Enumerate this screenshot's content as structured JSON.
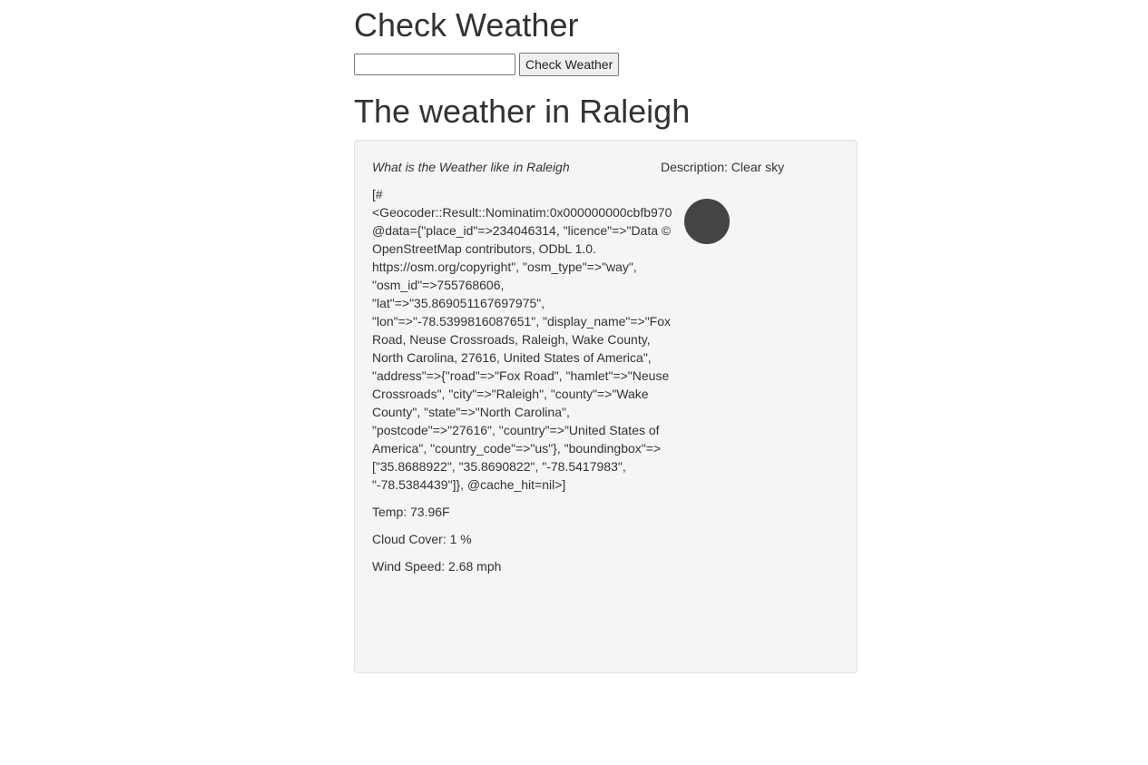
{
  "header": {
    "title": "Check Weather"
  },
  "search": {
    "input_value": "",
    "button_label": "Check Weather"
  },
  "result": {
    "heading": "The weather in Raleigh",
    "question": "What is the Weather like in Raleigh",
    "description": "Description: Clear sky",
    "geocoder_dump": "[#<Geocoder::Result::Nominatim:0x000000000cbfb970 @data={\"place_id\"=>234046314, \"licence\"=>\"Data © OpenStreetMap contributors, ODbL 1.0. https://osm.org/copyright\", \"osm_type\"=>\"way\", \"osm_id\"=>755768606, \"lat\"=>\"35.869051167697975\", \"lon\"=>\"-78.5399816087651\", \"display_name\"=>\"Fox Road, Neuse Crossroads, Raleigh, Wake County, North Carolina, 27616, United States of America\", \"address\"=>{\"road\"=>\"Fox Road\", \"hamlet\"=>\"Neuse Crossroads\", \"city\"=>\"Raleigh\", \"county\"=>\"Wake County\", \"state\"=>\"North Carolina\", \"postcode\"=>\"27616\", \"country\"=>\"United States of America\", \"country_code\"=>\"us\"}, \"boundingbox\"=>[\"35.8688922\", \"35.8690822\", \"-78.5417983\", \"-78.5384439\"]}, @cache_hit=nil>]",
    "temp": "Temp: 73.96F",
    "cloud_cover": "Cloud Cover: 1 %",
    "wind_speed": "Wind Speed: 2.68 mph",
    "icon": "weather-clear-icon",
    "icon_color": "#444444"
  },
  "colors": {
    "text": "#333333",
    "well_background": "#f5f5f5",
    "well_border": "#e3e3e3"
  }
}
